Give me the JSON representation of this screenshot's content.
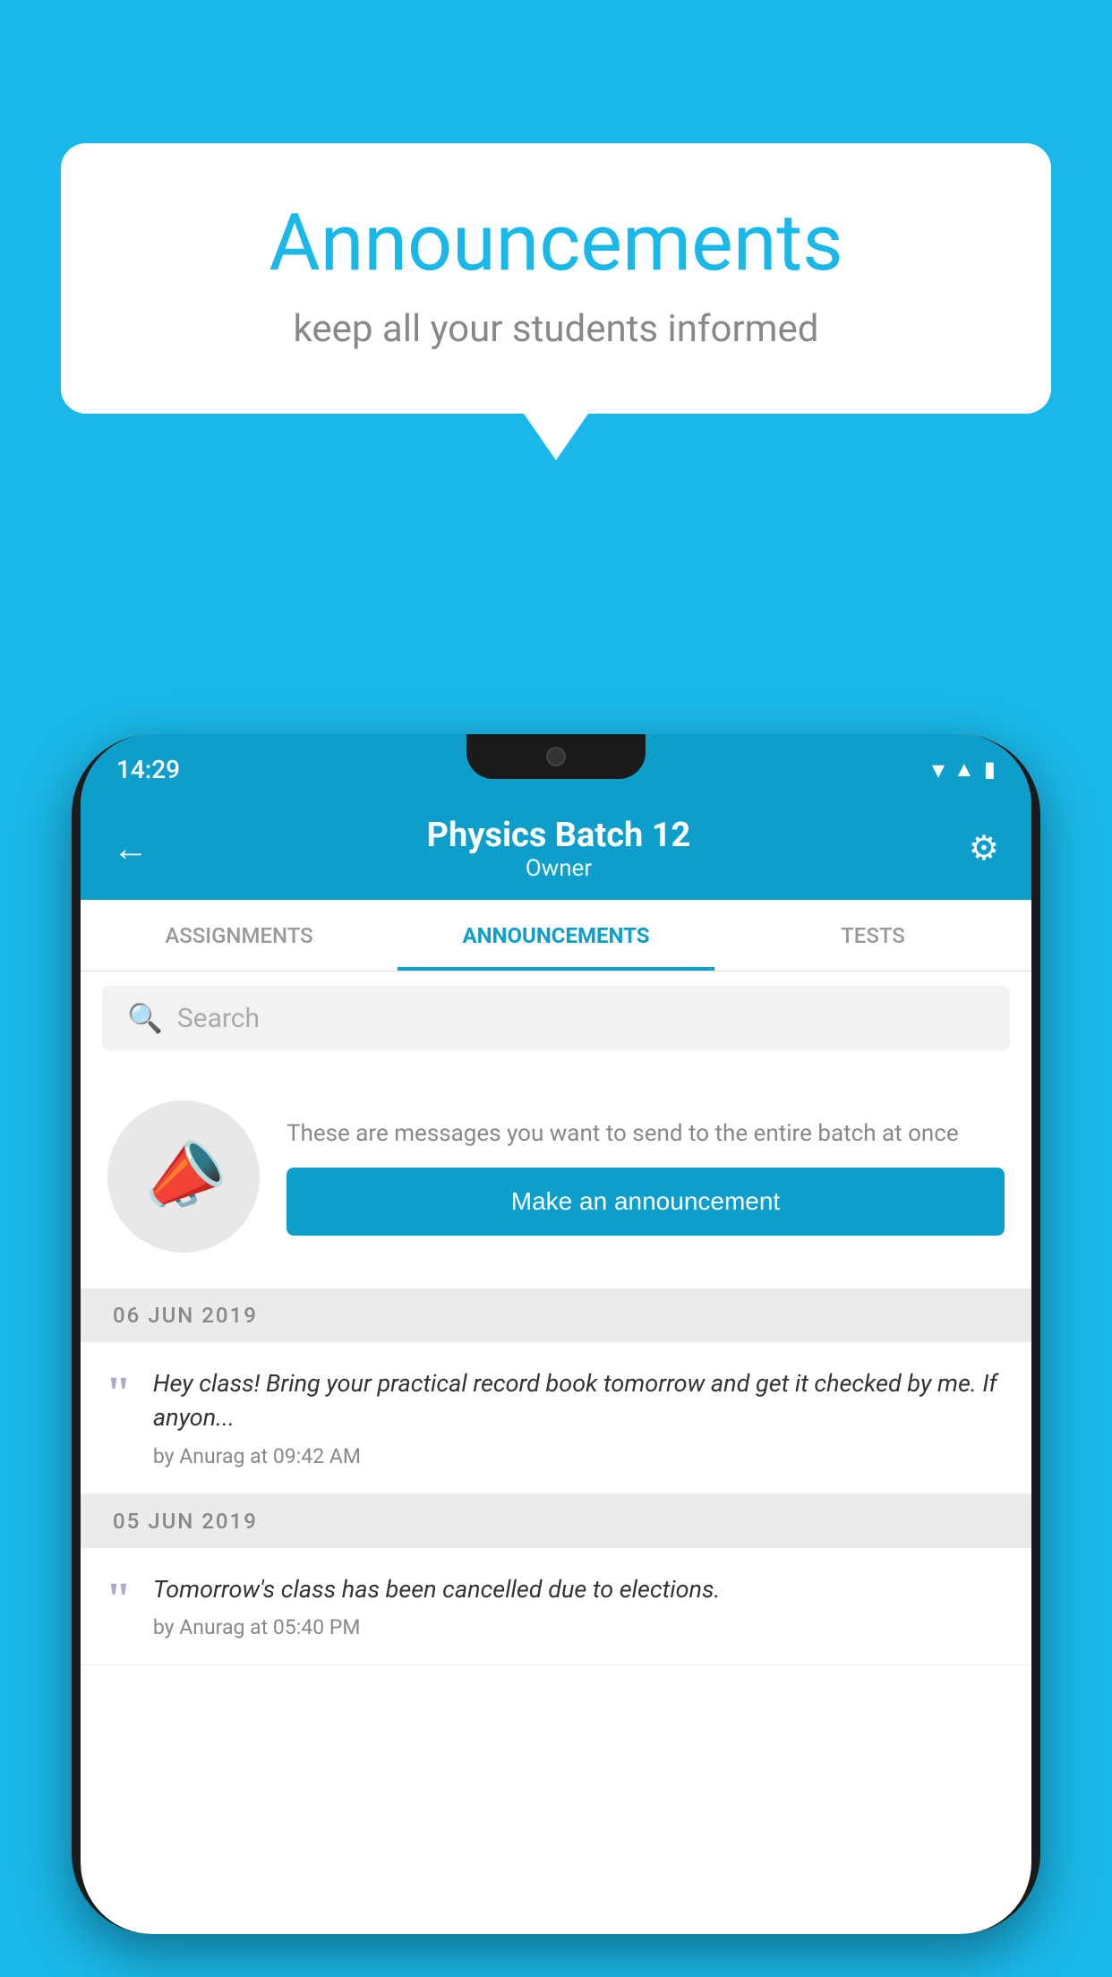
{
  "background": {
    "color": "#1ab8e8"
  },
  "speech_bubble": {
    "title": "Announcements",
    "subtitle": "keep all your students informed"
  },
  "phone": {
    "status_bar": {
      "time": "14:29",
      "wifi": "▾",
      "signal": "▲",
      "battery": "▮"
    },
    "header": {
      "title": "Physics Batch 12",
      "subtitle": "Owner",
      "back_label": "←",
      "settings_label": "⚙"
    },
    "tabs": [
      {
        "label": "ASSIGNMENTS",
        "active": false
      },
      {
        "label": "ANNOUNCEMENTS",
        "active": true
      },
      {
        "label": "TESTS",
        "active": false
      },
      {
        "label": "...",
        "active": false
      }
    ],
    "search": {
      "placeholder": "Search"
    },
    "promo": {
      "description": "These are messages you want to send to the entire batch at once",
      "button_label": "Make an announcement"
    },
    "announcements": [
      {
        "date": "06  JUN  2019",
        "text": "Hey class! Bring your practical record book tomorrow and get it checked by me. If anyon...",
        "meta": "by Anurag at 09:42 AM"
      },
      {
        "date": "05  JUN  2019",
        "text": "Tomorrow's class has been cancelled due to elections.",
        "meta": "by Anurag at 05:40 PM"
      }
    ]
  }
}
